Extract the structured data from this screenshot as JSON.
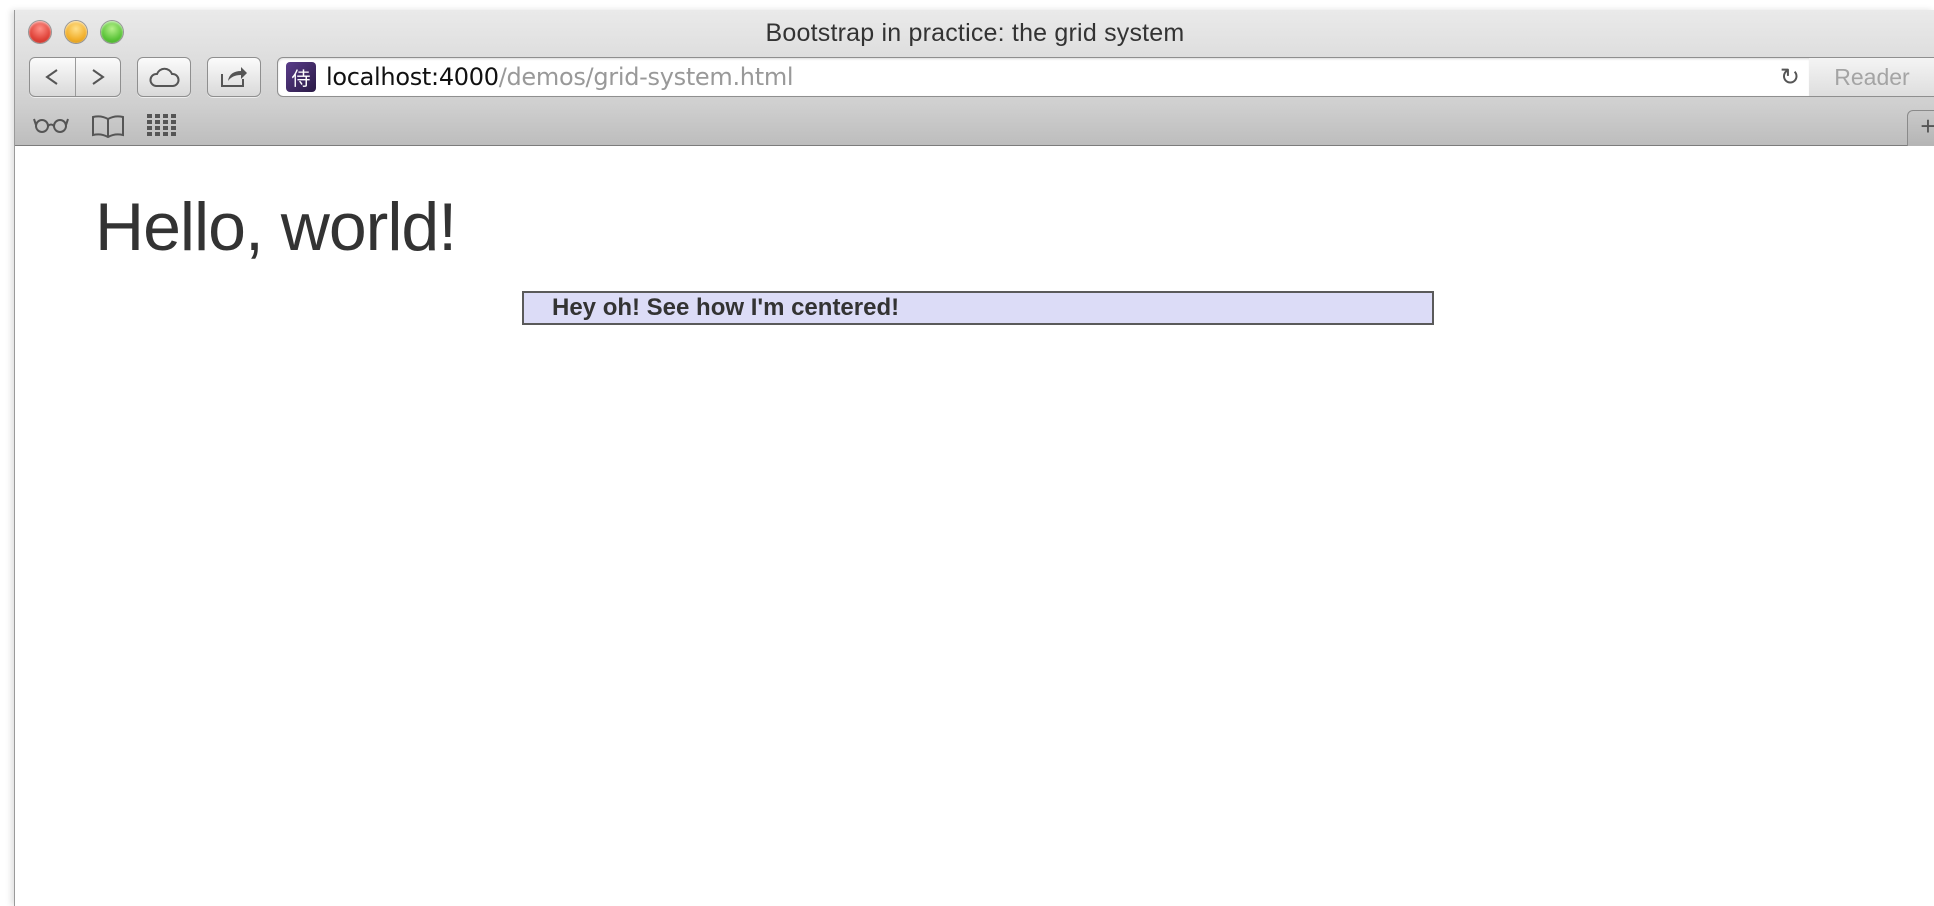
{
  "window": {
    "title": "Bootstrap in practice: the grid system"
  },
  "toolbar": {
    "back_icon": "back-arrow-icon",
    "forward_icon": "forward-arrow-icon",
    "cloud_icon": "cloud-tabs-icon",
    "share_icon": "share-icon",
    "reader_label": "Reader",
    "reload_icon": "reload-icon",
    "favicon_glyph": "侍"
  },
  "address_bar": {
    "host": "localhost:4000",
    "path": "/demos/grid-system.html"
  },
  "bookmarks_bar": {
    "icons": [
      "reading-list-icon",
      "bookmarks-icon",
      "top-sites-icon"
    ]
  },
  "page": {
    "heading": "Hello, world!",
    "centered_text": "Hey oh! See how I'm centered!"
  },
  "colors": {
    "box_background": "#dcdcf7",
    "box_border": "#5a5a5a",
    "text": "#333333"
  }
}
